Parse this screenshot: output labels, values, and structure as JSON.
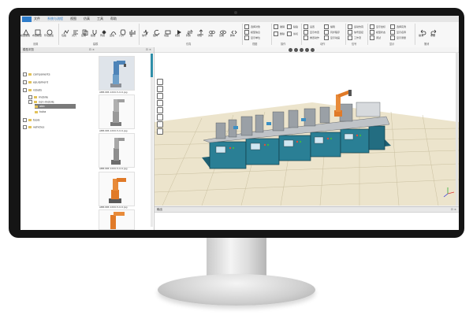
{
  "menubar": {
    "items": [
      "文件",
      "系统与流程",
      "视图",
      "仿真",
      "工具",
      "帮助"
    ]
  },
  "ribbon": {
    "big_buttons": [
      "模型加载",
      "布置模型",
      "环境属性",
      "包络",
      "对齐",
      "复制",
      "拾放",
      "传感",
      "运动",
      "八方",
      "图",
      "信号",
      "旋转",
      "动画",
      "视频",
      "转换",
      "导出",
      "关联",
      "查看",
      "脚本"
    ],
    "small_buttons_a": [
      "选择对象",
      "模型信息",
      "显示单位"
    ],
    "small_buttons_b": [
      "撤销",
      "删除",
      "粘贴",
      "剪切"
    ],
    "small_buttons_c": [
      "设置",
      "显示布置",
      "重置动作",
      "编辑",
      "同步程序",
      "显示动画"
    ],
    "small_buttons_d": [
      "运动仿真",
      "信号连接",
      "工作流"
    ],
    "small_buttons_e": [
      "显示坐标",
      "模型状态",
      "调试"
    ],
    "small_buttons_f": [
      "选择实例",
      "显示名称",
      "显示测量"
    ],
    "small_buttons_g": [
      "撤消",
      "重做"
    ],
    "group_labels": [
      "设置",
      "建模",
      "仿真",
      "视图",
      "操作",
      "动作",
      "信号",
      "显示",
      "撤消"
    ]
  },
  "tree": {
    "title": "模型浏览",
    "items": [
      "components",
      "equipment",
      "robots",
      "mobile",
      "non-mobile",
      "abb",
      "kuka",
      "tools",
      "vehicles"
    ]
  },
  "library": {
    "captions": [
      "ABB-IRB-1200-5-0-9.jpg",
      "ABB-IRB-1200-5-0-9.jpg",
      "ABB-IRB-1200-5-0-9.jpg",
      "ABB-IRB-1200-5-0-9.jpg"
    ]
  },
  "output": {
    "title": "输出"
  },
  "colors": {
    "accent": "#2d7ccb",
    "cabinet": "#2a7f95",
    "robot_orange": "#e07a28",
    "floor": "#e9dfc4"
  }
}
